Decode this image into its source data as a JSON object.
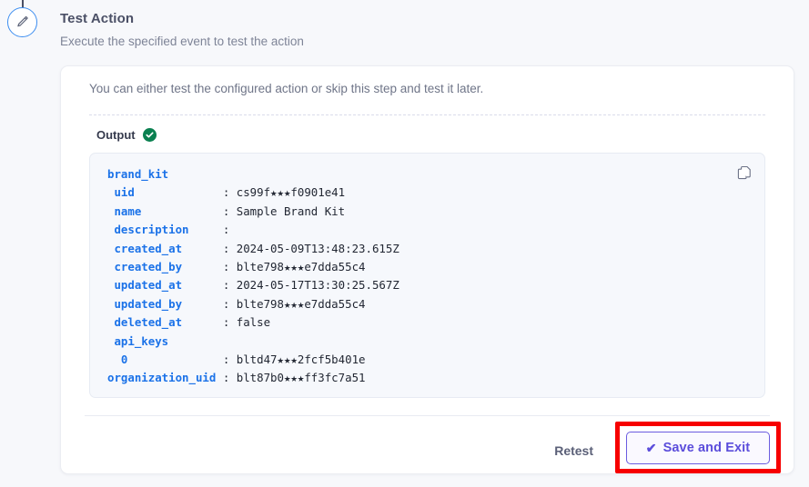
{
  "step": {
    "icon": "pencil-circle-icon",
    "title": "Test Action",
    "subtitle": "Execute the specified event to test the action"
  },
  "card": {
    "intro": "You can either test the configured action or skip this step and test it later.",
    "output_label": "Output",
    "status_icon": "green-check-circle-icon",
    "copy_icon": "copy-icon"
  },
  "output": {
    "root": "brand_kit",
    "rows": [
      {
        "key": "uid",
        "value": "cs99f★★★f0901e41",
        "indent": 1
      },
      {
        "key": "name",
        "value": "Sample Brand Kit",
        "indent": 1
      },
      {
        "key": "description",
        "value": "",
        "indent": 1
      },
      {
        "key": "created_at",
        "value": "2024-05-09T13:48:23.615Z",
        "indent": 1
      },
      {
        "key": "created_by",
        "value": "blte798★★★e7dda55c4",
        "indent": 1
      },
      {
        "key": "updated_at",
        "value": "2024-05-17T13:30:25.567Z",
        "indent": 1
      },
      {
        "key": "updated_by",
        "value": "blte798★★★e7dda55c4",
        "indent": 1
      },
      {
        "key": "deleted_at",
        "value": "false",
        "indent": 1
      },
      {
        "key": "api_keys",
        "value": null,
        "indent": 1
      },
      {
        "key": "0",
        "value": "bltd47★★★2fcf5b401e",
        "indent": 2
      },
      {
        "key": "organization_uid",
        "value": "blt87b0★★★ff3fc7a51",
        "indent": 0
      }
    ]
  },
  "footer": {
    "retest_label": "Retest",
    "save_label": "Save and Exit",
    "save_check_glyph": "✔",
    "highlight_color": "#f70000"
  },
  "colors": {
    "page_background": "#f7f8fb",
    "card_background": "#ffffff",
    "code_background": "#f6f8fc",
    "code_key": "#1b72e8",
    "code_value": "#222733",
    "title": "#4b5066",
    "subtitle": "#7e8497",
    "accent_purple": "#5b4ddb",
    "success_green": "#0a8050",
    "badge_blue": "#3d8ef0"
  }
}
